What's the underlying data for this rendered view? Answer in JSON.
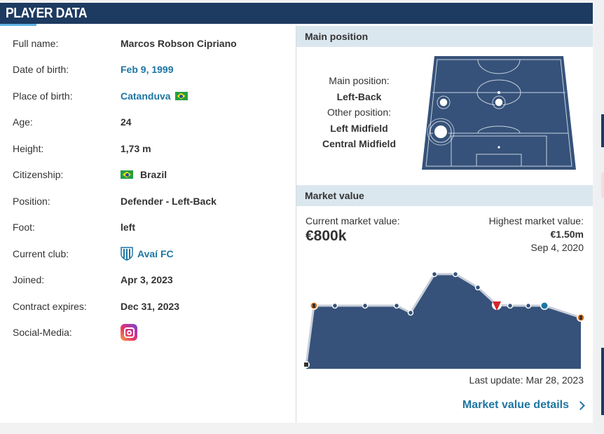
{
  "header": {
    "title": "PLAYER DATA"
  },
  "player": {
    "rows": [
      {
        "label": "Full name:",
        "value": "Marcos Robson Cipriano"
      },
      {
        "label": "Date of birth:",
        "value": "Feb 9, 1999"
      },
      {
        "label": "Place of birth:",
        "value": "Catanduva"
      },
      {
        "label": "Age:",
        "value": "24"
      },
      {
        "label": "Height:",
        "value": "1,73 m"
      },
      {
        "label": "Citizenship:",
        "value": "Brazil"
      },
      {
        "label": "Position:",
        "value": "Defender - Left-Back"
      },
      {
        "label": "Foot:",
        "value": "left"
      },
      {
        "label": "Current club:",
        "value": "Avaí FC"
      },
      {
        "label": "Joined:",
        "value": "Apr 3, 2023"
      },
      {
        "label": "Contract expires:",
        "value": "Dec 31, 2023"
      },
      {
        "label": "Social-Media:",
        "value": ""
      }
    ],
    "icons": {
      "flag": "brazil-flag-icon",
      "club": "avai-crest-icon",
      "social": "instagram-icon"
    }
  },
  "main_position": {
    "title": "Main position",
    "main_label": "Main position:",
    "main_value": "Left-Back",
    "other_label": "Other position:",
    "other_values": [
      "Left Midfield",
      "Central Midfield"
    ]
  },
  "market_value": {
    "title": "Market value",
    "current_label": "Current market value:",
    "current_value": "€800k",
    "highest_label": "Highest market value:",
    "highest_value": "€1.50m",
    "highest_date": "Sep 4, 2020",
    "last_update": "Last update: Mar 28, 2023",
    "details_link": "Market value details"
  },
  "colors": {
    "navy": "#1d3a60",
    "link": "#1d75a3",
    "section_bg": "#dbe7ef",
    "chart_fill": "#36527a"
  }
}
